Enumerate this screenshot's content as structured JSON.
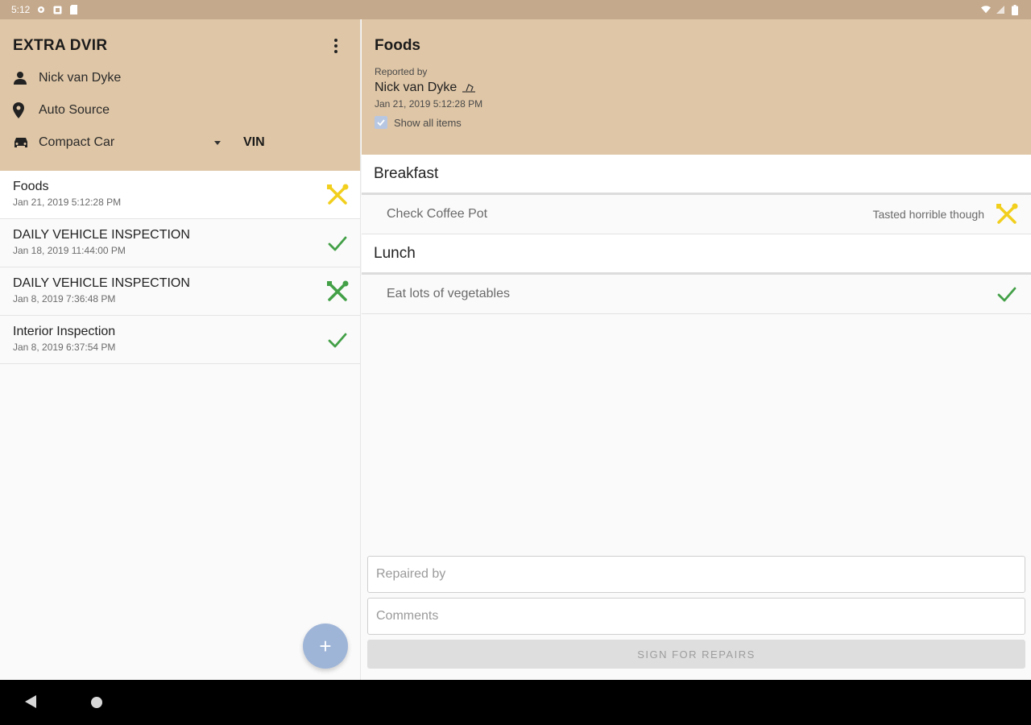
{
  "status_bar": {
    "time": "5:12"
  },
  "sidebar": {
    "app_title": "EXTRA DVIR",
    "driver_name": "Nick van Dyke",
    "location": "Auto Source",
    "vehicle": "Compact Car",
    "vin_label": "VIN",
    "reports": [
      {
        "title": "Foods",
        "date": "Jan 21, 2019 5:12:28 PM",
        "status": "needs-repair",
        "status_color": "#f2cf1d"
      },
      {
        "title": "DAILY VEHICLE INSPECTION",
        "date": "Jan 18, 2019 11:44:00 PM",
        "status": "ok",
        "status_color": "#43a047"
      },
      {
        "title": "DAILY VEHICLE INSPECTION",
        "date": "Jan 8, 2019 7:36:48 PM",
        "status": "repaired",
        "status_color": "#43a047"
      },
      {
        "title": "Interior Inspection",
        "date": "Jan 8, 2019 6:37:54 PM",
        "status": "ok",
        "status_color": "#43a047"
      }
    ],
    "fab_label": "+"
  },
  "detail": {
    "title": "Foods",
    "reported_by_label": "Reported by",
    "reporter_name": "Nick van Dyke",
    "date": "Jan 21, 2019 5:12:28 PM",
    "show_all_label": "Show all items",
    "show_all_checked": true,
    "sections": [
      {
        "name": "Breakfast",
        "items": [
          {
            "label": "Check Coffee Pot",
            "note": "Tasted horrible though",
            "status": "needs-repair"
          }
        ]
      },
      {
        "name": "Lunch",
        "items": [
          {
            "label": "Eat lots of vegetables",
            "note": "",
            "status": "ok"
          }
        ]
      }
    ],
    "repaired_by_placeholder": "Repaired by",
    "comments_placeholder": "Comments",
    "sign_button_label": "SIGN FOR REPAIRS"
  },
  "colors": {
    "header_bg": "#dfc6a6",
    "status_bar_bg": "#c4a98c",
    "fab": "#9fb5d8",
    "ok": "#43a047",
    "warn": "#f2cf1d"
  }
}
